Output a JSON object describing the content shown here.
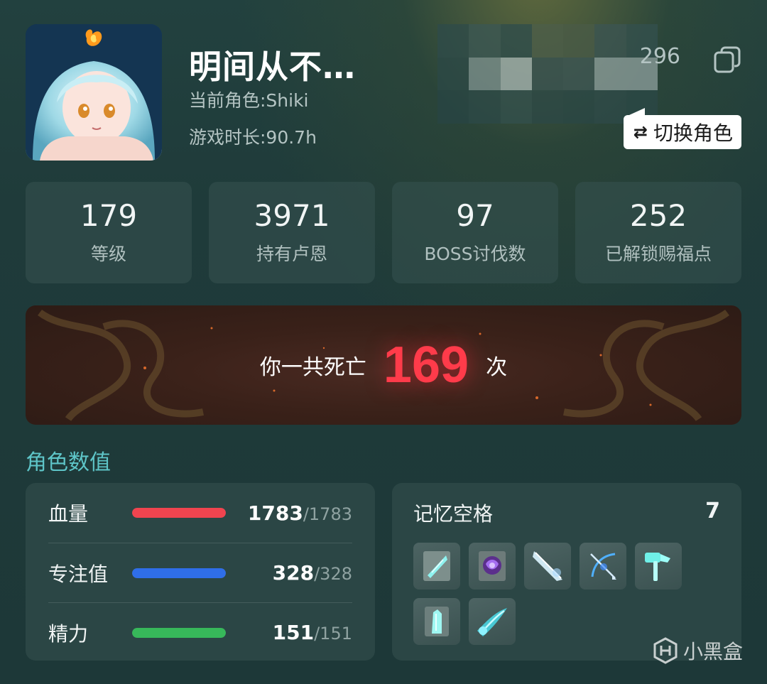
{
  "profile": {
    "name": "明间从不…",
    "role": "当前角色:Shiki",
    "playtime": "游戏时长:90.7h",
    "uid": "296",
    "switch_label": "切换角色",
    "switch_icon": "⇄"
  },
  "stats": [
    {
      "value": "179",
      "label": "等级"
    },
    {
      "value": "3971",
      "label": "持有卢恩"
    },
    {
      "value": "97",
      "label": "BOSS讨伐数"
    },
    {
      "value": "252",
      "label": "已解锁赐福点"
    }
  ],
  "death": {
    "prefix": "你一共死亡",
    "count": "169",
    "suffix": "次"
  },
  "section_title": "角色数值",
  "attributes": [
    {
      "label": "血量",
      "value": "1783",
      "max": "/1783",
      "fill": 1.0,
      "color": "#f0444f"
    },
    {
      "label": "专注值",
      "value": "328",
      "max": "/328",
      "fill": 1.0,
      "color": "#2f6ee8"
    },
    {
      "label": "精力",
      "value": "151",
      "max": "/151",
      "fill": 1.0,
      "color": "#37b85a"
    }
  ],
  "memory": {
    "title": "记忆空格",
    "count": "7",
    "spells": [
      "crystal-spell-icon",
      "purple-spell-icon",
      "blade-spell-icon",
      "bow-spell-icon",
      "hammer-spell-icon",
      "shard-spell-icon",
      "comet-spell-icon"
    ]
  },
  "watermark": {
    "text": "小黑盒"
  },
  "colors": {
    "accent": "#5ec5c8",
    "death_count": "#ff3b4a"
  }
}
